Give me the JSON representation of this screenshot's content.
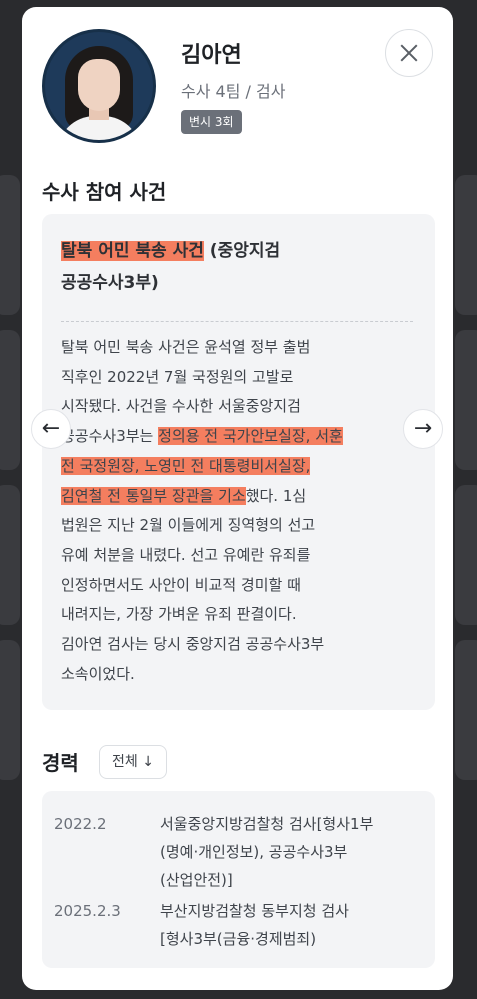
{
  "profile": {
    "name": "김아연",
    "role": "수사 4팀 / 검사",
    "badge": "변시 3회"
  },
  "cases_section": {
    "title": "수사 참여 사건",
    "case": {
      "title_highlight": "탈북 어민 북송 사건",
      "title_rest": " (중앙지검",
      "title_line2": "공공수사3부)",
      "body": [
        [
          {
            "t": "탈북 어민 북송 사건은 윤석열 정부 출범",
            "h": false
          }
        ],
        [
          {
            "t": "직후인 2022년 7월 국정원의 고발로",
            "h": false
          }
        ],
        [
          {
            "t": "시작됐다. 사건을 수사한 서울중앙지검",
            "h": false
          }
        ],
        [
          {
            "t": "공공수사3부는 ",
            "h": false
          },
          {
            "t": "정의용 전 국가안보실장, 서훈",
            "h": true
          }
        ],
        [
          {
            "t": "전 국정원장, 노영민 전 대통령비서실장,",
            "h": true
          }
        ],
        [
          {
            "t": "김연철 전 통일부 장관을 기소",
            "h": true
          },
          {
            "t": "했다. 1심",
            "h": false
          }
        ],
        [
          {
            "t": "법원은 지난 2월 이들에게 징역형의 선고",
            "h": false
          }
        ],
        [
          {
            "t": "유예 처분을 내렸다. 선고 유예란 유죄를",
            "h": false
          }
        ],
        [
          {
            "t": "인정하면서도 사안이 비교적 경미할 때",
            "h": false
          }
        ],
        [
          {
            "t": "내려지는, 가장 가벼운 유죄 판결이다.",
            "h": false
          }
        ],
        [
          {
            "t": "김아연 검사는 당시 중앙지검 공공수사3부",
            "h": false
          }
        ],
        [
          {
            "t": "소속이었다.",
            "h": false
          }
        ]
      ]
    },
    "prev_arrow": "←",
    "next_arrow": "→"
  },
  "career": {
    "title": "경력",
    "filter_label": "전체 ↓",
    "items": [
      {
        "date": "2022.2",
        "lines": [
          "서울중앙지방검찰청 검사[형사1부",
          "(명예·개인정보), 공공수사3부",
          "(산업안전)]"
        ]
      },
      {
        "date": "2025.2.3",
        "lines": [
          "부산지방검찰청 동부지청 검사",
          "[형사3부(금융·경제범죄)"
        ]
      }
    ]
  },
  "colors": {
    "highlight": "#f47e5f",
    "card_bg": "#f3f4f6",
    "badge_bg": "#6b7079"
  }
}
